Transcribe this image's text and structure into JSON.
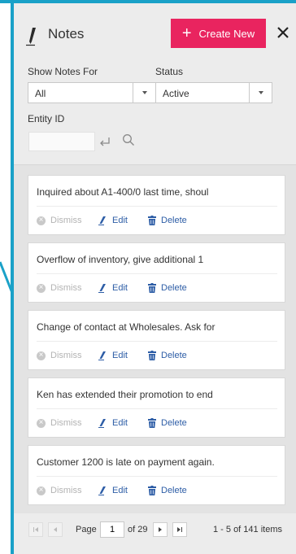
{
  "header": {
    "title": "Notes",
    "create_label": "Create New",
    "create_icon": "plus-icon",
    "close_icon": "close-icon",
    "title_icon": "pencil-icon"
  },
  "filters": {
    "show_notes_for_label": "Show Notes For",
    "show_notes_for_value": "All",
    "status_label": "Status",
    "status_value": "Active",
    "entity_id_label": "Entity ID",
    "entity_id_value": ""
  },
  "notes": [
    {
      "text": "Inquired about A1-400/0 last time, shoul",
      "dismiss": "Dismiss",
      "edit": "Edit",
      "delete": "Delete"
    },
    {
      "text": "Overflow of inventory, give additional 1",
      "dismiss": "Dismiss",
      "edit": "Edit",
      "delete": "Delete"
    },
    {
      "text": "Change of contact at Wholesales. Ask for",
      "dismiss": "Dismiss",
      "edit": "Edit",
      "delete": "Delete"
    },
    {
      "text": "Ken has extended their promotion to end",
      "dismiss": "Dismiss",
      "edit": "Edit",
      "delete": "Delete"
    },
    {
      "text": "Customer 1200 is late on payment again.",
      "dismiss": "Dismiss",
      "edit": "Edit",
      "delete": "Delete"
    }
  ],
  "pager": {
    "page_label": "Page",
    "current_page": "1",
    "of_pages": "of 29",
    "summary": "1 - 5 of 141 items"
  },
  "colors": {
    "accent": "#1aa1c8",
    "create_button": "#e9245f",
    "action_link": "#2d5da6"
  }
}
